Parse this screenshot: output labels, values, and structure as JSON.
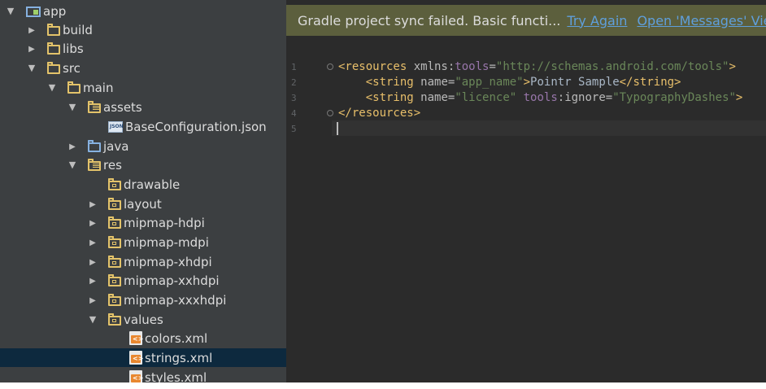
{
  "project_tree": {
    "items": [
      {
        "label": "app",
        "arrow": "open",
        "icon": "module-icon",
        "selected": false
      },
      {
        "label": "build",
        "arrow": "closed",
        "icon": "folder-icon",
        "selected": false
      },
      {
        "label": "libs",
        "arrow": "closed",
        "icon": "folder-icon",
        "selected": false
      },
      {
        "label": "src",
        "arrow": "open",
        "icon": "folder-icon",
        "selected": false
      },
      {
        "label": "main",
        "arrow": "open",
        "icon": "folder-icon",
        "selected": false
      },
      {
        "label": "assets",
        "arrow": "open",
        "icon": "assets-folder-icon",
        "selected": false
      },
      {
        "label": "BaseConfiguration.json",
        "arrow": "none",
        "icon": "json-file-icon",
        "selected": false
      },
      {
        "label": "java",
        "arrow": "closed",
        "icon": "java-source-folder-icon",
        "selected": false
      },
      {
        "label": "res",
        "arrow": "open",
        "icon": "res-folder-icon",
        "selected": false
      },
      {
        "label": "drawable",
        "arrow": "none",
        "icon": "folder-icon",
        "selected": false
      },
      {
        "label": "layout",
        "arrow": "closed",
        "icon": "folder-icon",
        "selected": false
      },
      {
        "label": "mipmap-hdpi",
        "arrow": "closed",
        "icon": "folder-icon",
        "selected": false
      },
      {
        "label": "mipmap-mdpi",
        "arrow": "closed",
        "icon": "folder-icon",
        "selected": false
      },
      {
        "label": "mipmap-xhdpi",
        "arrow": "closed",
        "icon": "folder-icon",
        "selected": false
      },
      {
        "label": "mipmap-xxhdpi",
        "arrow": "closed",
        "icon": "folder-icon",
        "selected": false
      },
      {
        "label": "mipmap-xxxhdpi",
        "arrow": "closed",
        "icon": "folder-icon",
        "selected": false
      },
      {
        "label": "values",
        "arrow": "open",
        "icon": "folder-icon",
        "selected": false
      },
      {
        "label": "colors.xml",
        "arrow": "none",
        "icon": "xml-file-icon",
        "selected": false
      },
      {
        "label": "strings.xml",
        "arrow": "none",
        "icon": "xml-file-icon",
        "selected": true
      },
      {
        "label": "styles.xml",
        "arrow": "none",
        "icon": "xml-file-icon",
        "selected": false
      }
    ],
    "json_icon_text": "JSON",
    "xml_icon_text": "<>"
  },
  "banner": {
    "message": "Gradle project sync failed. Basic functi...",
    "try_again": "Try Again",
    "open_messages": "Open 'Messages' View"
  },
  "editor": {
    "line_numbers": [
      "1",
      "2",
      "3",
      "4",
      "5"
    ],
    "lines": {
      "l1": {
        "open": "<resources ",
        "attr1": "xmlns:",
        "ns": "tools",
        "eq": "=",
        "val": "\"http://schemas.android.com/tools\"",
        "close": ">"
      },
      "l2": {
        "indent": "    ",
        "open": "<string ",
        "attr": "name=",
        "val": "\"app_name\"",
        "gt": ">",
        "text": "Pointr Sample",
        "end": "</string>"
      },
      "l3": {
        "indent": "    ",
        "open": "<string ",
        "attr": "name=",
        "val": "\"licence\"",
        "sp": " ",
        "ns": "tools",
        "attr2": ":ignore=",
        "val2": "\"TypographyDashes\"",
        "gt": ">"
      },
      "l4": {
        "close": "</resources>"
      }
    }
  },
  "colors": {
    "tree_bg": "#3c3f41",
    "selection": "#0d293e",
    "editor_bg": "#2b2b2b",
    "banner_bg": "#5c5f3d",
    "link": "#5f9fdc",
    "tag": "#e8bf6a",
    "string_value": "#6a8759",
    "namespace": "#9876aa"
  }
}
